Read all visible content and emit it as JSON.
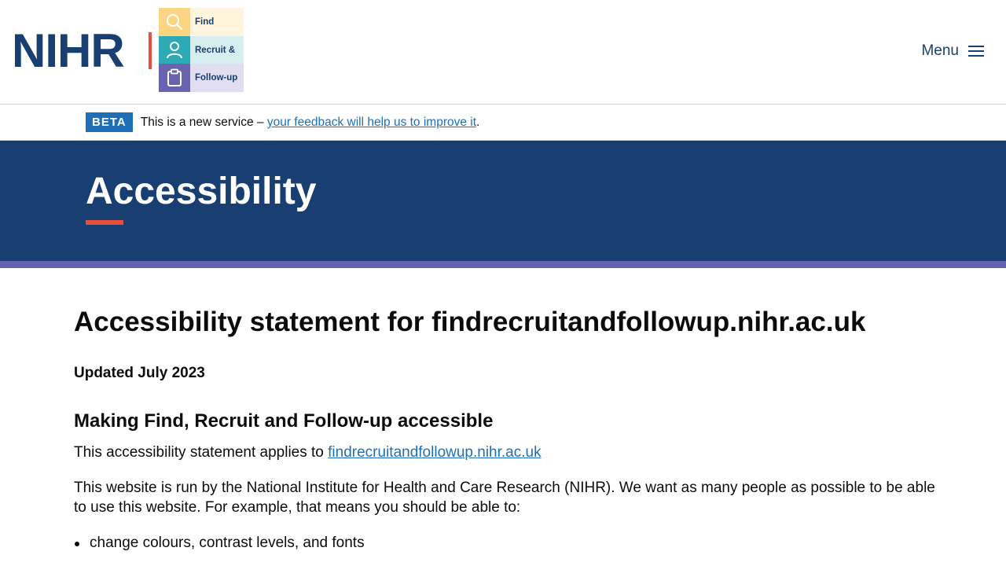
{
  "header": {
    "logo": {
      "wordmark": "NIHR",
      "tiles": [
        {
          "label": "Find",
          "icon": "search-icon",
          "icon_bg": "#fcd583",
          "text_bg": "#fff4dc"
        },
        {
          "label": "Recruit &",
          "icon": "person-icon",
          "icon_bg": "#2eaab4",
          "text_bg": "#d7eef0"
        },
        {
          "label": "Follow-up",
          "icon": "clipboard-icon",
          "icon_bg": "#6a64b0",
          "text_bg": "#e1def2"
        }
      ]
    },
    "menu_label": "Menu"
  },
  "beta_banner": {
    "tag": "BETA",
    "text": "This is a new service –",
    "link_text": "your feedback will help us to improve it",
    "suffix": "."
  },
  "hero": {
    "title": "Accessibility"
  },
  "content": {
    "heading": "Accessibility statement for findrecruitandfollowup.nihr.ac.uk",
    "updated": "Updated July 2023",
    "subheading": "Making Find, Recruit and Follow-up accessible",
    "applies_text": "This accessibility statement applies to",
    "applies_link": "findrecruitandfollowup.nihr.ac.uk",
    "paragraph": "This website is run by the National Institute for Health and Care Research (NIHR). We want as many people as possible to be able to use this website. For example, that means you should be able to:",
    "list": [
      "change colours, contrast levels, and fonts"
    ]
  },
  "colors": {
    "brand_navy": "#193e72",
    "accent_red": "#e84d3d",
    "stripe_purple": "#6464ae",
    "link_blue": "#1d70b8"
  }
}
